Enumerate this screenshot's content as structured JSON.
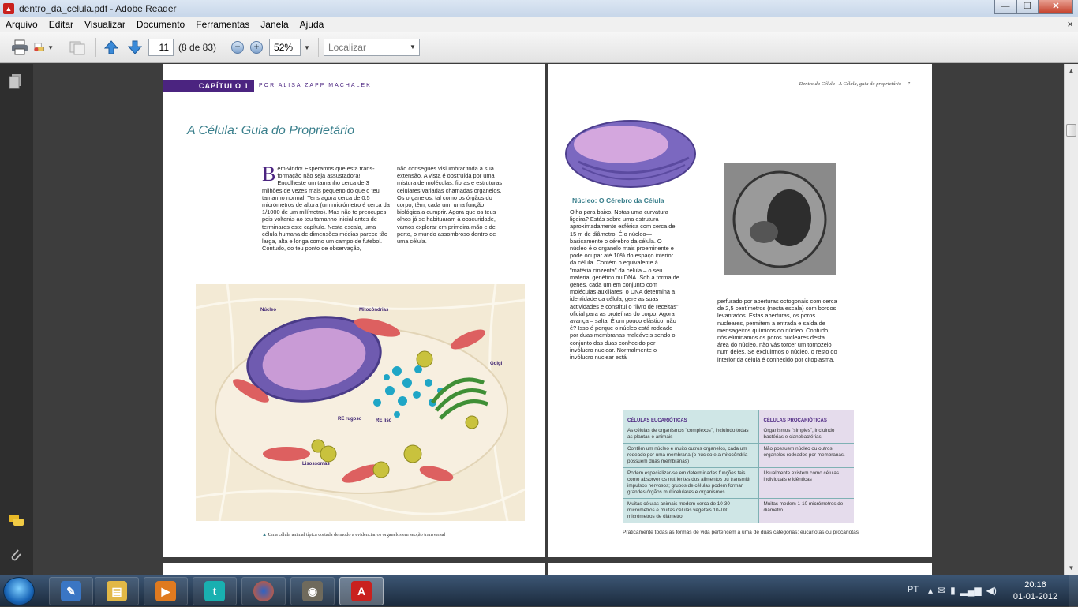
{
  "window": {
    "title": "dentro_da_celula.pdf - Adobe Reader",
    "minimize_glyph": "—",
    "maximize_glyph": "❐",
    "close_glyph": "✕"
  },
  "menubar": {
    "items": [
      "Arquivo",
      "Editar",
      "Visualizar",
      "Documento",
      "Ferramentas",
      "Janela",
      "Ajuda"
    ],
    "close_doc_glyph": "×"
  },
  "toolbar": {
    "page_number": "11",
    "page_count": "(8 de 83)",
    "zoom_out_glyph": "−",
    "zoom_in_glyph": "+",
    "zoom": "52%",
    "find_placeholder": "Localizar",
    "dropdown_glyph": "▼",
    "icons": [
      "printer-icon",
      "email-icon",
      "collaborate-icon",
      "previous-page-icon",
      "next-page-icon"
    ]
  },
  "left_page": {
    "chapter": "CAPÍTULO 1",
    "author": "POR ALISA ZAPP MACHALEK",
    "title": "A Célula: Guia do Proprietário",
    "dropcap": "B",
    "col1": "em-vindo! Esperamos que esta trans-formação não seja assustadora! Encolheste um tamanho cerca de 3 milhões de vezes mais pequeno do que o teu tamanho normal. Tens agora cerca de 0,5 micrómetros de altura (um micrómetro é cerca da 1/1000 de um milímetro). Mas não te preocupes, pois voltarás ao teu tamanho inicial antes de terminares este capítulo. Nesta escala, uma célula humana de dimensões médias parece tão larga, alta e longa como um campo de futebol. Contudo, do teu ponto de observação,",
    "col2": "não consegues vislumbrar toda a sua extensão. A vista é obstruída por uma mistura de moléculas, fibras e estruturas celulares variadas chamadas organelos. Os organelos, tal como os órgãos do corpo, têm, cada um, uma função biológica a cumprir. Agora que os teus olhos já se habituaram à obscuridade, vamos explorar em primeira-mão e de perto, o mundo assombroso dentro de uma célula.",
    "figure_labels": {
      "nucleus": "Núcleo",
      "mitochondria": "Mitocôndrias",
      "golgi": "Golgi",
      "rough_er": "RE rugoso",
      "smooth_er": "RE liso",
      "lysosomes": "Lisossomas"
    },
    "caption": "Uma célula animal típica cortada de modo a evidenciar os organelos em secção transversal"
  },
  "right_page": {
    "running_head": "Dentro da Célula | A Célula, guia do proprietário",
    "page_num": "7",
    "section_title": "Núcleo: O Cérebro da Célula",
    "col1": "Olha para baixo. Notas uma curvatura ligeira? Estás sobre uma estrutura aproximadamente esférica com cerca de 15 m de diâmetro. É o núcleo— basicamente o cérebro da célula. O núcleo é o organelo mais proeminente e pode ocupar até 10% do espaço interior da célula. Contém o equivalente à \"matéria cinzenta\" da célula – o seu material genético ou DNA. Sob a forma de genes, cada um em conjunto com moléculas auxiliares, o DNA determina a identidade da célula, gere as suas actividades e constitui o \"livro de receitas\" oficial para as proteínas do corpo. Agora avança – salta. É um pouco elástico, não é? Isso é porque o núcleo está rodeado por duas membranas maleáveis sendo o conjunto das duas conhecido por invólucro nuclear. Normalmente o invólucro nuclear está",
    "col2": "perfurado por aberturas octogonais com cerca de 2,5 centímetros (nesta escala) com bordos levantados. Estas aberturas, os poros nucleares, permitem a entrada e saída de mensageiros químicos do núcleo. Contudo, nós eliminamos os poros nucleares desta área do núcleo, não vás torcer um tornozelo num deles. Se excluirmos o núcleo, o resto do interior da célula é conhecido por citoplasma.",
    "table": {
      "head_euk": "CÉLULAS EUCARIÓTICAS",
      "head_pro": "CÉLULAS PROCARIÓTICAS",
      "rows": [
        [
          "As células de organismos \"complexos\", incluindo todas as plantas e animais",
          "Organismos \"simples\", incluindo bactérias e cianobactérias"
        ],
        [
          "Contêm um núcleo e muito outros organelos, cada um rodeado por uma membrana (o núcleo e a mitocôndria possuem duas membranas)",
          "Não possuem núcleo ou outros organelos rodeados por membranas."
        ],
        [
          "Podem especializar-se em determinadas funções tais como absorver os nutrientes dos alimentos ou transmitir impulsos nervosos; grupos de células podem formar grandes órgãos multicelulares e organismos",
          "Usualmente existem como células individuais e idênticas"
        ],
        [
          "Muitas células animais medem cerca de 10-30 micrómetros e muitas células vegetais 10-100 micrómetros de diâmetro",
          "Muitas medem 1-10 micrómetros de diâmetro"
        ]
      ],
      "note": "Praticamente todas as formas de vida pertencem a uma de duas categorias: eucariotas ou procariotas"
    }
  },
  "taskbar": {
    "apps": [
      "windows-explorer",
      "file-manager",
      "media-player",
      "tumblr",
      "firefox",
      "gimp",
      "adobe-reader"
    ],
    "language": "PT",
    "time": "20:16",
    "date": "01-01-2012"
  },
  "colors": {
    "chapter_purple": "#4b2480",
    "title_teal": "#3a7f8c",
    "table_teal": "#cfe6e6",
    "table_lilac": "#e5dcec"
  }
}
